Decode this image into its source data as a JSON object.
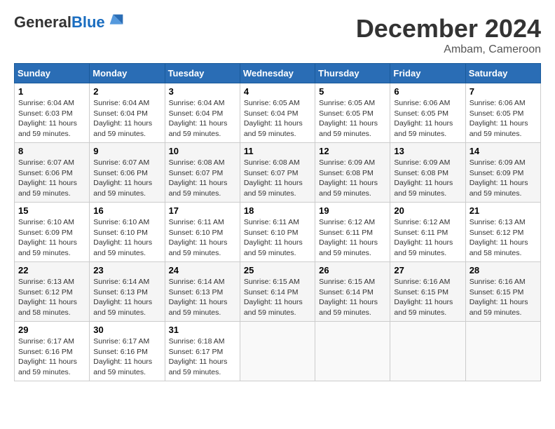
{
  "header": {
    "logo_general": "General",
    "logo_blue": "Blue",
    "month_title": "December 2024",
    "location": "Ambam, Cameroon"
  },
  "days_of_week": [
    "Sunday",
    "Monday",
    "Tuesday",
    "Wednesday",
    "Thursday",
    "Friday",
    "Saturday"
  ],
  "weeks": [
    [
      {
        "day": "1",
        "sunrise": "6:04 AM",
        "sunset": "6:03 PM",
        "daylight": "11 hours and 59 minutes."
      },
      {
        "day": "2",
        "sunrise": "6:04 AM",
        "sunset": "6:04 PM",
        "daylight": "11 hours and 59 minutes."
      },
      {
        "day": "3",
        "sunrise": "6:04 AM",
        "sunset": "6:04 PM",
        "daylight": "11 hours and 59 minutes."
      },
      {
        "day": "4",
        "sunrise": "6:05 AM",
        "sunset": "6:04 PM",
        "daylight": "11 hours and 59 minutes."
      },
      {
        "day": "5",
        "sunrise": "6:05 AM",
        "sunset": "6:05 PM",
        "daylight": "11 hours and 59 minutes."
      },
      {
        "day": "6",
        "sunrise": "6:06 AM",
        "sunset": "6:05 PM",
        "daylight": "11 hours and 59 minutes."
      },
      {
        "day": "7",
        "sunrise": "6:06 AM",
        "sunset": "6:05 PM",
        "daylight": "11 hours and 59 minutes."
      }
    ],
    [
      {
        "day": "8",
        "sunrise": "6:07 AM",
        "sunset": "6:06 PM",
        "daylight": "11 hours and 59 minutes."
      },
      {
        "day": "9",
        "sunrise": "6:07 AM",
        "sunset": "6:06 PM",
        "daylight": "11 hours and 59 minutes."
      },
      {
        "day": "10",
        "sunrise": "6:08 AM",
        "sunset": "6:07 PM",
        "daylight": "11 hours and 59 minutes."
      },
      {
        "day": "11",
        "sunrise": "6:08 AM",
        "sunset": "6:07 PM",
        "daylight": "11 hours and 59 minutes."
      },
      {
        "day": "12",
        "sunrise": "6:09 AM",
        "sunset": "6:08 PM",
        "daylight": "11 hours and 59 minutes."
      },
      {
        "day": "13",
        "sunrise": "6:09 AM",
        "sunset": "6:08 PM",
        "daylight": "11 hours and 59 minutes."
      },
      {
        "day": "14",
        "sunrise": "6:09 AM",
        "sunset": "6:09 PM",
        "daylight": "11 hours and 59 minutes."
      }
    ],
    [
      {
        "day": "15",
        "sunrise": "6:10 AM",
        "sunset": "6:09 PM",
        "daylight": "11 hours and 59 minutes."
      },
      {
        "day": "16",
        "sunrise": "6:10 AM",
        "sunset": "6:10 PM",
        "daylight": "11 hours and 59 minutes."
      },
      {
        "day": "17",
        "sunrise": "6:11 AM",
        "sunset": "6:10 PM",
        "daylight": "11 hours and 59 minutes."
      },
      {
        "day": "18",
        "sunrise": "6:11 AM",
        "sunset": "6:10 PM",
        "daylight": "11 hours and 59 minutes."
      },
      {
        "day": "19",
        "sunrise": "6:12 AM",
        "sunset": "6:11 PM",
        "daylight": "11 hours and 59 minutes."
      },
      {
        "day": "20",
        "sunrise": "6:12 AM",
        "sunset": "6:11 PM",
        "daylight": "11 hours and 59 minutes."
      },
      {
        "day": "21",
        "sunrise": "6:13 AM",
        "sunset": "6:12 PM",
        "daylight": "11 hours and 58 minutes."
      }
    ],
    [
      {
        "day": "22",
        "sunrise": "6:13 AM",
        "sunset": "6:12 PM",
        "daylight": "11 hours and 58 minutes."
      },
      {
        "day": "23",
        "sunrise": "6:14 AM",
        "sunset": "6:13 PM",
        "daylight": "11 hours and 59 minutes."
      },
      {
        "day": "24",
        "sunrise": "6:14 AM",
        "sunset": "6:13 PM",
        "daylight": "11 hours and 59 minutes."
      },
      {
        "day": "25",
        "sunrise": "6:15 AM",
        "sunset": "6:14 PM",
        "daylight": "11 hours and 59 minutes."
      },
      {
        "day": "26",
        "sunrise": "6:15 AM",
        "sunset": "6:14 PM",
        "daylight": "11 hours and 59 minutes."
      },
      {
        "day": "27",
        "sunrise": "6:16 AM",
        "sunset": "6:15 PM",
        "daylight": "11 hours and 59 minutes."
      },
      {
        "day": "28",
        "sunrise": "6:16 AM",
        "sunset": "6:15 PM",
        "daylight": "11 hours and 59 minutes."
      }
    ],
    [
      {
        "day": "29",
        "sunrise": "6:17 AM",
        "sunset": "6:16 PM",
        "daylight": "11 hours and 59 minutes."
      },
      {
        "day": "30",
        "sunrise": "6:17 AM",
        "sunset": "6:16 PM",
        "daylight": "11 hours and 59 minutes."
      },
      {
        "day": "31",
        "sunrise": "6:18 AM",
        "sunset": "6:17 PM",
        "daylight": "11 hours and 59 minutes."
      },
      null,
      null,
      null,
      null
    ]
  ]
}
